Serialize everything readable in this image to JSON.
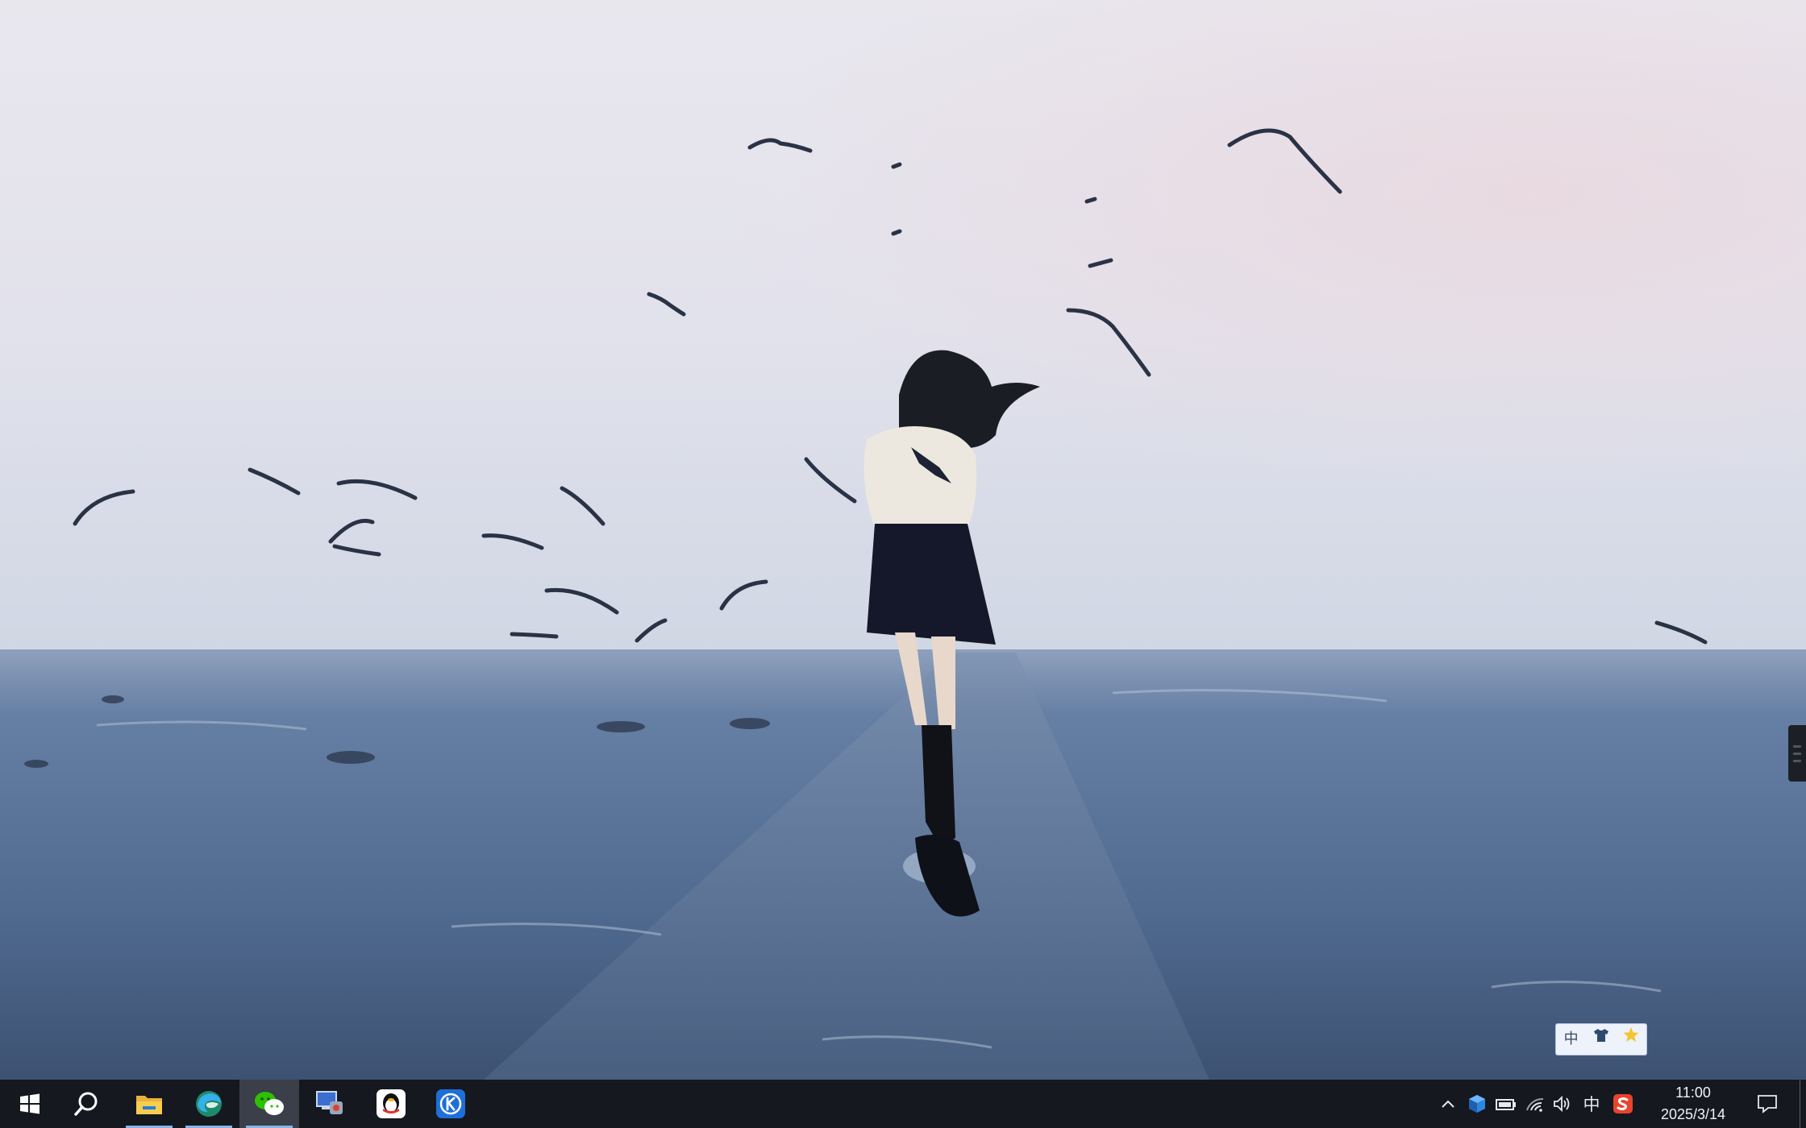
{
  "desktop": {
    "wallpaper": "seaside-girl-with-seagulls",
    "colors": {
      "sky_top": "#e8e6ee",
      "sky_horizon": "#d2d8e6",
      "sea": "#536b90",
      "taskbar": "#15181f",
      "accent_underline": "#8bb4e6"
    }
  },
  "ime_toolbar": {
    "mode": "中",
    "items": [
      "中",
      "shirt-icon",
      "star-icon"
    ]
  },
  "taskbar": {
    "start_icon": "windows-start-icon",
    "search_icon": "search-icon",
    "apps": [
      {
        "name": "File Explorer",
        "icon": "folder-icon",
        "open": true,
        "active": false
      },
      {
        "name": "Microsoft Edge",
        "icon": "edge-icon",
        "open": true,
        "active": false
      },
      {
        "name": "WeChat",
        "icon": "wechat-icon",
        "open": true,
        "active": true
      },
      {
        "name": "Remote Desktop",
        "icon": "computer-icon",
        "open": false,
        "active": false
      },
      {
        "name": "QQ",
        "icon": "qq-penguin-icon",
        "open": false,
        "active": false
      },
      {
        "name": "Kuwo",
        "icon": "k-app-icon",
        "open": false,
        "active": false
      }
    ],
    "tray": {
      "chevron": "^",
      "input_language": "中",
      "icons": [
        "cube-icon",
        "battery-icon",
        "wifi-icon",
        "volume-icon",
        "sogou-icon"
      ]
    },
    "clock": {
      "time": "11:00",
      "date": "2025/3/14"
    },
    "notification_icon": "action-center-icon"
  }
}
